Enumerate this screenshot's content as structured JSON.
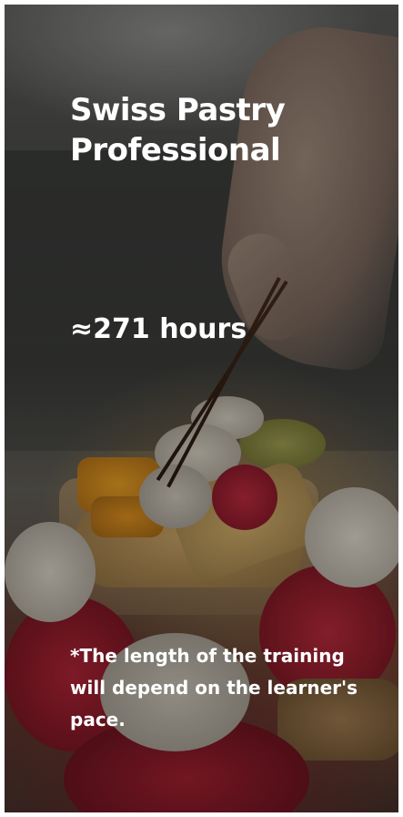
{
  "card": {
    "title_line1": "Swiss Pastry",
    "title_line2": "Professional",
    "duration": "≈271 hours",
    "footnote": "*The length of the training will depend on the learner's pace.",
    "background_image": "pastry-chef-decorating-fruit-tarts-photo"
  },
  "colors": {
    "text": "#ffffff",
    "page_background": "#ffffff"
  }
}
